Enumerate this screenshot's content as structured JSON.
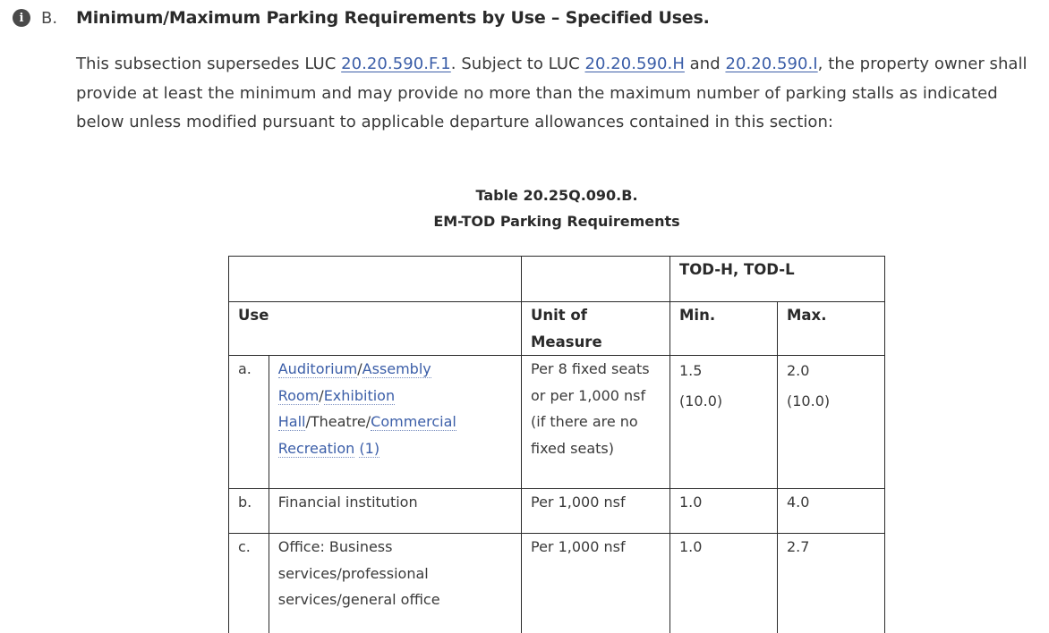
{
  "section": {
    "letter": "B.",
    "title": "Minimum/Maximum Parking Requirements by Use – Specified Uses."
  },
  "paragraph": {
    "part1": "This subsection supersedes LUC ",
    "link1": "20.20.590.F.1",
    "part2": ". Subject to LUC ",
    "link2": "20.20.590.H",
    "part3": " and ",
    "link3": "20.20.590.I",
    "part4": ", the property owner shall provide at least the minimum and may provide no more than the maximum number of parking stalls as indicated below unless modified pursuant to applicable departure allowances contained in this section:"
  },
  "table": {
    "caption_line1": "Table 20.25Q.090.B.",
    "caption_line2": "EM-TOD Parking Requirements",
    "district_header": "TOD-H, TOD-L",
    "col_use": "Use",
    "col_unit": "Unit of Measure",
    "col_min": "Min.",
    "col_max": "Max.",
    "rows": [
      {
        "letter": "a.",
        "use_link1": "Auditorium",
        "use_sep1": "/",
        "use_link2": "Assembly Room",
        "use_sep2": "/",
        "use_link3": "Exhibition Hall",
        "use_sep3": "/Theatre/",
        "use_link4": "Commercial Recreation",
        "use_link5": "(1)",
        "unit": "Per 8 fixed seats or per 1,000 nsf (if there are no fixed seats)",
        "min": "1.5",
        "min_sub": "(10.0)",
        "max": "2.0",
        "max_sub": "(10.0)"
      },
      {
        "letter": "b.",
        "use": "Financial institution",
        "unit": "Per 1,000 nsf",
        "min": "1.0",
        "max": "4.0"
      },
      {
        "letter": "c.",
        "use": "Office: Business services/professional services/general office",
        "unit": "Per 1,000 nsf",
        "min": "1.0",
        "max": "2.7"
      }
    ]
  }
}
